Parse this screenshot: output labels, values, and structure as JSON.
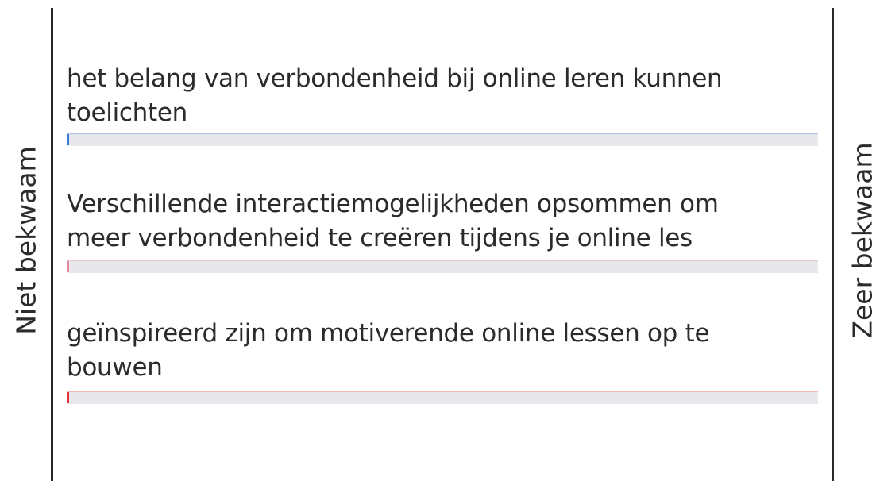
{
  "scale": {
    "left_label": "Niet bekwaam",
    "right_label": "Zeer bekwaam"
  },
  "statements": [
    {
      "text": "het belang van verbondenheid bij online leren kunnen\ntoelichten",
      "value_percent": 0,
      "color": "#3b7bd9",
      "track_line_color": "#a9c3ec"
    },
    {
      "text": "Verschillende interactiemogelijkheden opsommen om\nmeer verbondenheid te creëren tijdens je online les",
      "value_percent": 0,
      "color": "#e88a9e",
      "track_line_color": "#f2c2cc"
    },
    {
      "text": "geïnspireerd zijn om motiverende online lessen op te\nbouwen",
      "value_percent": 0,
      "color": "#e0303a",
      "track_line_color": "#f0b9b6"
    }
  ]
}
